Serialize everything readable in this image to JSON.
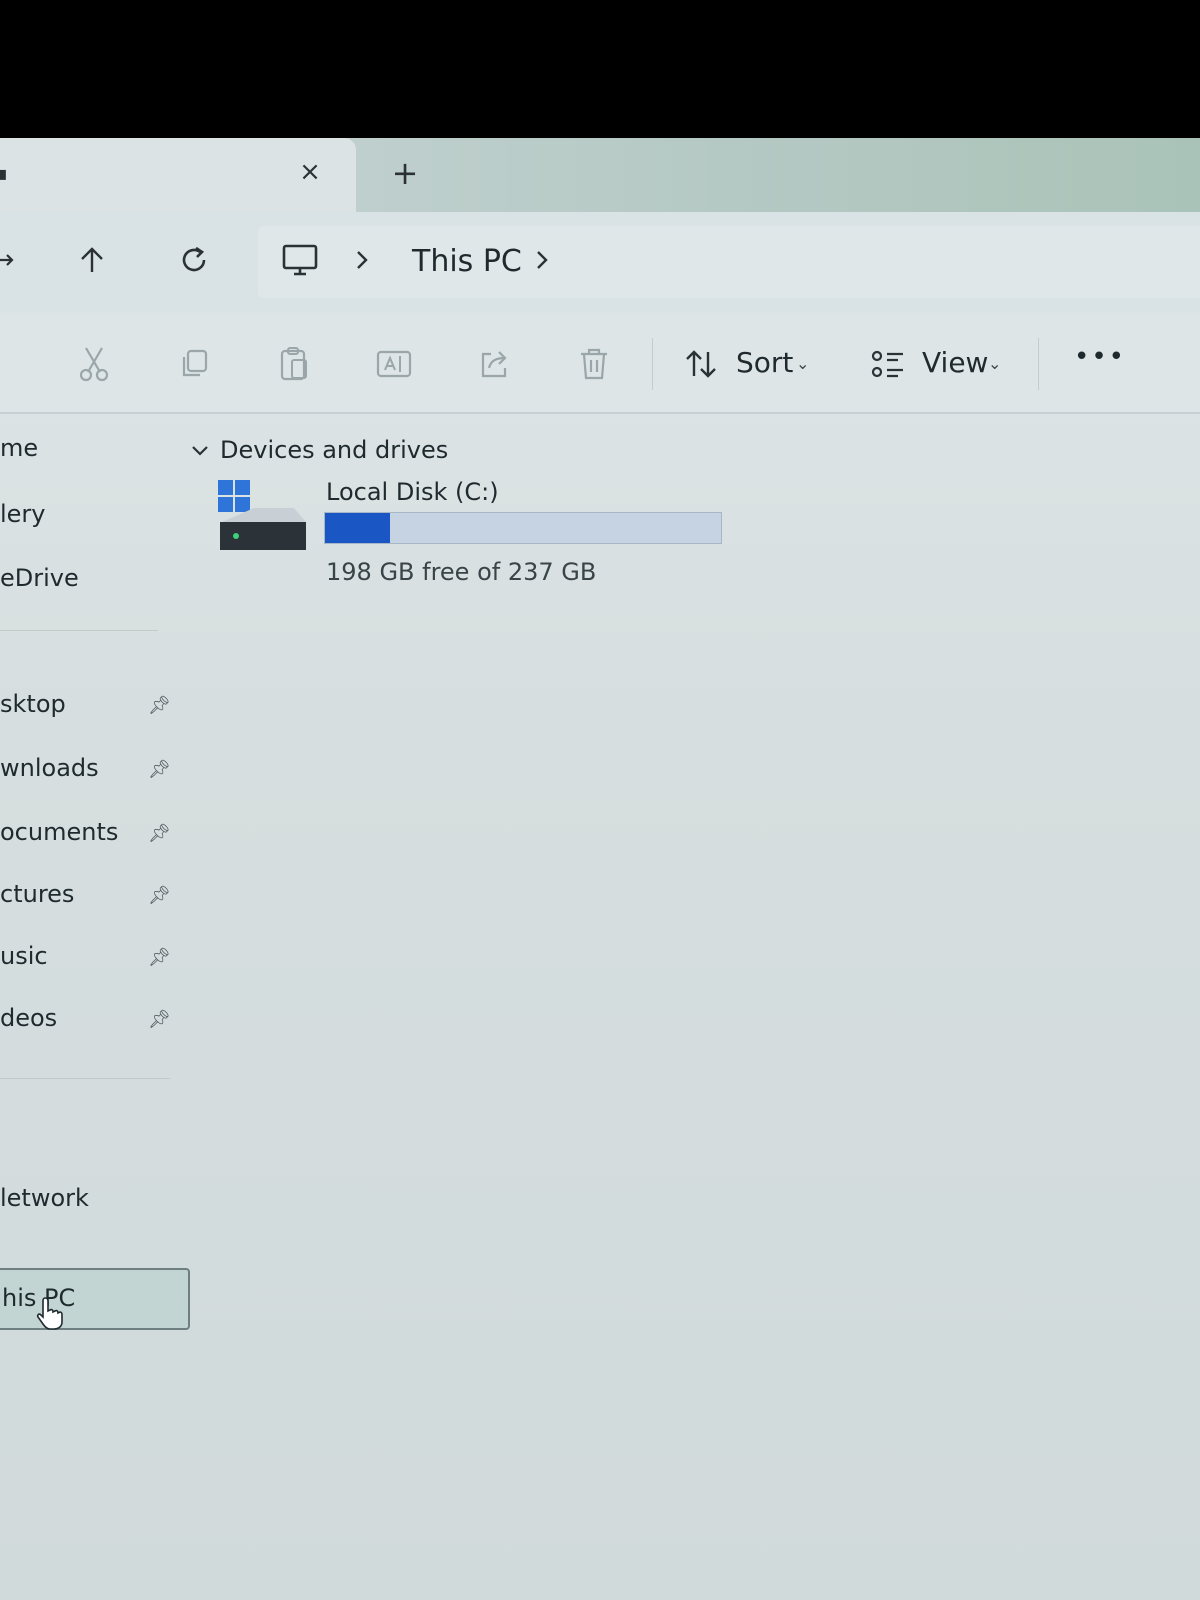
{
  "tabs": {
    "close_label": "×",
    "new_label": "+"
  },
  "address": {
    "segments": [
      "This PC"
    ]
  },
  "toolbar": {
    "sort_label": "Sort",
    "view_label": "View",
    "more_label": "•••"
  },
  "sidebar": {
    "quick": [
      "me",
      "lery",
      "eDrive"
    ],
    "pinned": [
      "sktop",
      "wnloads",
      "ocuments",
      "ctures",
      "usic",
      "deos"
    ],
    "selected": "his PC",
    "network": "letwork"
  },
  "content": {
    "group_title": "Devices and drives",
    "drive": {
      "name": "Local Disk (C:)",
      "free_text": "198 GB free of 237 GB",
      "used_fraction": 0.165
    }
  },
  "colors": {
    "accent": "#1a56c4",
    "bar_track": "#c6d3e2"
  }
}
